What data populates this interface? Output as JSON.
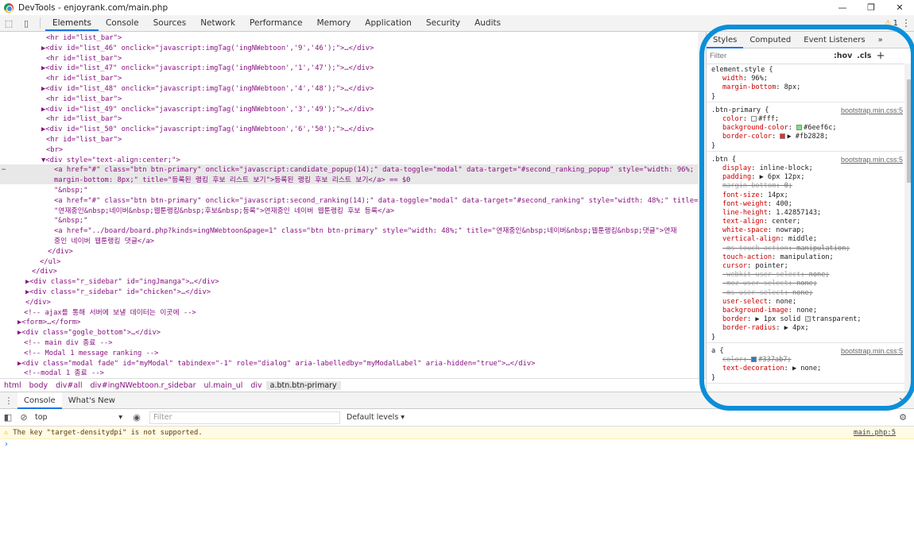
{
  "window": {
    "title": "DevTools - enjoyrank.com/main.php",
    "minimize": "—",
    "maximize": "❐",
    "close": "✕"
  },
  "toolbar": {
    "tabs": [
      "Elements",
      "Console",
      "Sources",
      "Network",
      "Performance",
      "Memory",
      "Application",
      "Security",
      "Audits"
    ],
    "active_tab": "Elements",
    "warning_count": "1"
  },
  "elements_lines": [
    {
      "i": 58,
      "t": "<hr id=\"list_bar\">"
    },
    {
      "i": 52,
      "t": "▶<div id=\"list_46\" onclick=\"javascript:imgTag('ingNWebtoon','9','46');\">…</div>"
    },
    {
      "i": 58,
      "t": "<hr id=\"list_bar\">"
    },
    {
      "i": 52,
      "t": "▶<div id=\"list_47\" onclick=\"javascript:imgTag('ingNWebtoon','1','47');\">…</div>"
    },
    {
      "i": 58,
      "t": "<hr id=\"list_bar\">"
    },
    {
      "i": 52,
      "t": "▶<div id=\"list_48\" onclick=\"javascript:imgTag('ingNWebtoon','4','48');\">…</div>"
    },
    {
      "i": 58,
      "t": "<hr id=\"list_bar\">"
    },
    {
      "i": 52,
      "t": "▶<div id=\"list_49\" onclick=\"javascript:imgTag('ingNWebtoon','3','49');\">…</div>"
    },
    {
      "i": 58,
      "t": "<hr id=\"list_bar\">"
    },
    {
      "i": 52,
      "t": "▶<div id=\"list_50\" onclick=\"javascript:imgTag('ingNWebtoon','6','50');\">…</div>"
    },
    {
      "i": 58,
      "t": "<hr id=\"list_bar\">"
    },
    {
      "i": 58,
      "t": "<br>"
    },
    {
      "i": 52,
      "t": "▼<div style=\"text-align:center;\">"
    },
    {
      "i": 68,
      "t": "<a href=\"#\" class=\"btn btn-primary\" onclick=\"javascript:candidate_popup(14);\" data-toggle=\"modal\" data-target=\"#second_ranking_popup\" style=\"width: 96%;"
    },
    {
      "i": 68,
      "t": "margin-bottom: 8px;\" title=\"등록된 랭킹 후보 리스트 보기\">등록된 랭킹 후보 리스트 보기</a> == $0"
    },
    {
      "i": 68,
      "t": "\"&nbsp;\""
    },
    {
      "i": 68,
      "t": "<a href=\"#\" class=\"btn btn-primary\" onclick=\"javascript:second_ranking(14);\" data-toggle=\"modal\" data-target=\"#second_ranking\" style=\"width: 48%;\" title="
    },
    {
      "i": 68,
      "t": "\"연재중인&nbsp;네이버&nbsp;웹툰랭킹&nbsp;후보&nbsp;등록\">연재중인 네이버 웹툰랭킹 후보 등록</a>"
    },
    {
      "i": 68,
      "t": "\"&nbsp;\""
    },
    {
      "i": 68,
      "t": "<a href=\"../board/board.php?kinds=ingNWebtoon&page=1\" class=\"btn btn-primary\" style=\"width: 48%;\" title=\"연재중인&nbsp;네이버&nbsp;웹툰랭킹&nbsp;댓글\">연재"
    },
    {
      "i": 68,
      "t": "중인 네이버 웹툰랭킹 댓글</a>"
    },
    {
      "i": 60,
      "t": "</div>"
    },
    {
      "i": 50,
      "t": "</ul>"
    },
    {
      "i": 40,
      "t": "</div>"
    },
    {
      "i": 32,
      "t": "▶<div class=\"r_sidebar\" id=\"ingJmanga\">…</div>"
    },
    {
      "i": 32,
      "t": "▶<div class=\"r_sidebar\" id=\"chicken\">…</div>"
    },
    {
      "i": 32,
      "t": "</div>"
    },
    {
      "i": 30,
      "t": "<!-- ajax를 통해 서버에 보낼 데이터는 이곳에 -->"
    },
    {
      "i": 22,
      "t": "▶<form>…</form>"
    },
    {
      "i": 22,
      "t": "▶<div class=\"gogle_bottom\">…</div>"
    },
    {
      "i": 30,
      "t": "<!-- main div 종료 -->"
    },
    {
      "i": 30,
      "t": "<!-- Modal 1 message ranking -->"
    },
    {
      "i": 22,
      "t": "▶<div class=\"modal fade\" id=\"myModal\" tabindex=\"-1\" role=\"dialog\" aria-labelledby=\"myModalLabel\" aria-hidden=\"true\">…</div>"
    },
    {
      "i": 30,
      "t": "<!--modal 1 종료 -->"
    }
  ],
  "breadcrumb": [
    "html",
    "body",
    "div#all",
    "div#ingNWebtoon.r_sidebar",
    "ul.main_ul",
    "div",
    "a.btn.btn-primary"
  ],
  "styles": {
    "tabs": [
      "Styles",
      "Computed",
      "Event Listeners",
      "»"
    ],
    "filter_placeholder": "Filter",
    "hov": ":hov",
    "cls": ".cls",
    "plus": "+",
    "rules": [
      {
        "selector": "element.style {",
        "source": "",
        "lines": [
          {
            "p": "width",
            "v": "96%;"
          },
          {
            "p": "margin-bottom",
            "v": "8px;"
          }
        ]
      },
      {
        "selector": ".btn-primary {",
        "source": "bootstrap.min.css:5",
        "lines": [
          {
            "p": "color",
            "v": "#fff;",
            "sw": "#ffffff"
          },
          {
            "p": "background-color",
            "v": "#6eef6c;",
            "sw": "#6eef6c"
          },
          {
            "p": "border-color",
            "v": "▶ #fb2828;",
            "sw": "#fb2828"
          }
        ]
      },
      {
        "selector": ".btn {",
        "source": "bootstrap.min.css:5",
        "lines": [
          {
            "p": "display",
            "v": "inline-block;"
          },
          {
            "p": "padding",
            "v": "▶ 6px 12px;"
          },
          {
            "p": "margin-bottom",
            "v": "0;",
            "s": true
          },
          {
            "p": "font-size",
            "v": "14px;"
          },
          {
            "p": "font-weight",
            "v": "400;"
          },
          {
            "p": "line-height",
            "v": "1.42857143;"
          },
          {
            "p": "text-align",
            "v": "center;"
          },
          {
            "p": "white-space",
            "v": "nowrap;"
          },
          {
            "p": "vertical-align",
            "v": "middle;"
          },
          {
            "p": "-ms-touch-action",
            "v": "manipulation;",
            "s": true
          },
          {
            "p": "touch-action",
            "v": "manipulation;"
          },
          {
            "p": "cursor",
            "v": "pointer;"
          },
          {
            "p": "-webkit-user-select",
            "v": "none;",
            "s": true
          },
          {
            "p": "-moz-user-select",
            "v": "none;",
            "s": true
          },
          {
            "p": "-ms-user-select",
            "v": "none;",
            "s": true
          },
          {
            "p": "user-select",
            "v": "none;"
          },
          {
            "p": "background-image",
            "v": "none;"
          },
          {
            "p": "border",
            "v": "▶ 1px solid ",
            "sw": "transparent",
            "v2": "transparent;"
          },
          {
            "p": "border-radius",
            "v": "▶ 4px;"
          }
        ]
      },
      {
        "selector": "a {",
        "source": "bootstrap.min.css:5",
        "lines": [
          {
            "p": "color",
            "v": "#337ab7;",
            "sw": "#337ab7",
            "s": true
          },
          {
            "p": "text-decoration",
            "v": "▶ none;"
          }
        ]
      }
    ]
  },
  "drawer": {
    "tabs": [
      "Console",
      "What's New"
    ],
    "context": "top",
    "filter_placeholder": "Filter",
    "levels": "Default levels ▾",
    "warning": "The key \"target-densitydpi\" is not supported.",
    "warning_source": "main.php:5",
    "prompt": "›"
  },
  "colors": {
    "accent": "#1a73e8",
    "annotation": "#0a8fd9"
  }
}
